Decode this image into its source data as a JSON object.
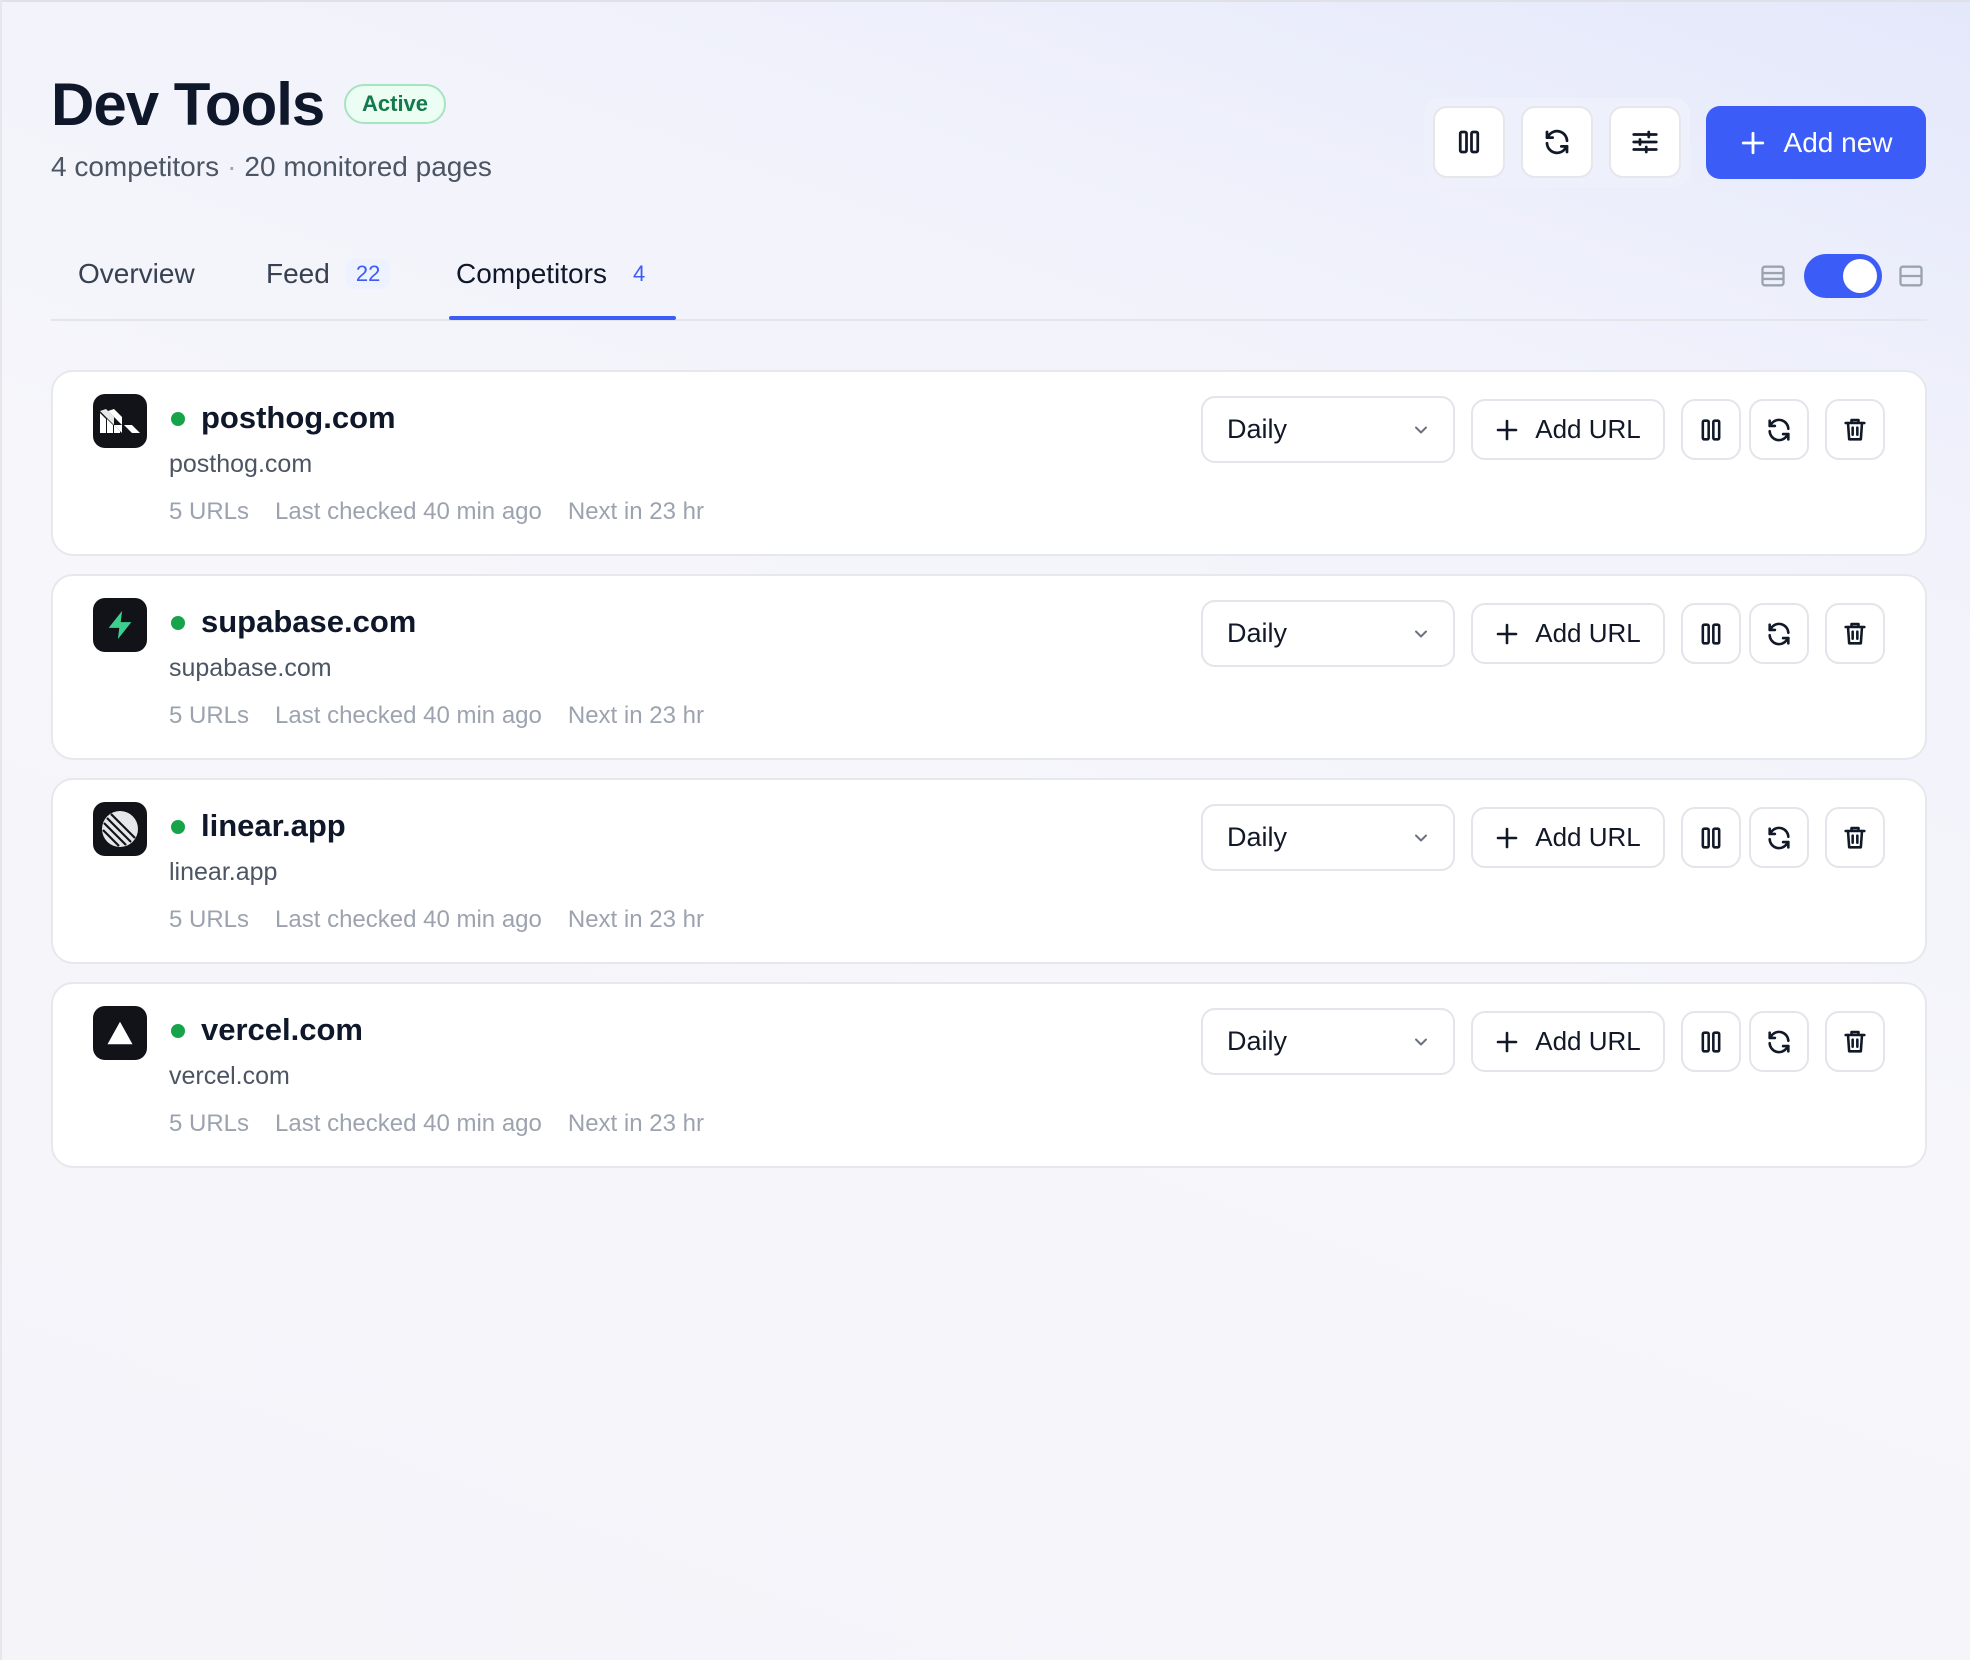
{
  "header": {
    "title": "Dev Tools",
    "status_badge": "Active",
    "competitors_count": "4 competitors",
    "separator": "·",
    "monitored_pages": "20 monitored pages",
    "add_new_label": "Add new",
    "toolbar_icons": [
      "pause-icon",
      "refresh-icon",
      "sliders-icon"
    ]
  },
  "tabs": [
    {
      "label": "Overview",
      "count": ""
    },
    {
      "label": "Feed",
      "count": "22"
    },
    {
      "label": "Competitors",
      "count": "4",
      "active": true
    }
  ],
  "view_toggle": {
    "on": true
  },
  "competitors": [
    {
      "name": "posthog.com",
      "url": "posthog.com",
      "urls": "5 URLs",
      "last_checked": "Last checked 40 min ago",
      "next": "Next in 23 hr",
      "frequency": "Daily",
      "add_url_label": "Add URL",
      "logo_icon": "posthog-logo-icon"
    },
    {
      "name": "supabase.com",
      "url": "supabase.com",
      "urls": "5 URLs",
      "last_checked": "Last checked 40 min ago",
      "next": "Next in 23 hr",
      "frequency": "Daily",
      "add_url_label": "Add URL",
      "logo_icon": "supabase-logo-icon"
    },
    {
      "name": "linear.app",
      "url": "linear.app",
      "urls": "5 URLs",
      "last_checked": "Last checked 40 min ago",
      "next": "Next in 23 hr",
      "frequency": "Daily",
      "add_url_label": "Add URL",
      "logo_icon": "linear-logo-icon"
    },
    {
      "name": "vercel.com",
      "url": "vercel.com",
      "urls": "5 URLs",
      "last_checked": "Last checked 40 min ago",
      "next": "Next in 23 hr",
      "frequency": "Daily",
      "add_url_label": "Add URL",
      "logo_icon": "vercel-logo-icon"
    }
  ],
  "colors": {
    "accent": "#3b5cf6",
    "status_green": "#16a34a",
    "badge_green": "#137a4b",
    "muted_text": "#9ca3af"
  }
}
